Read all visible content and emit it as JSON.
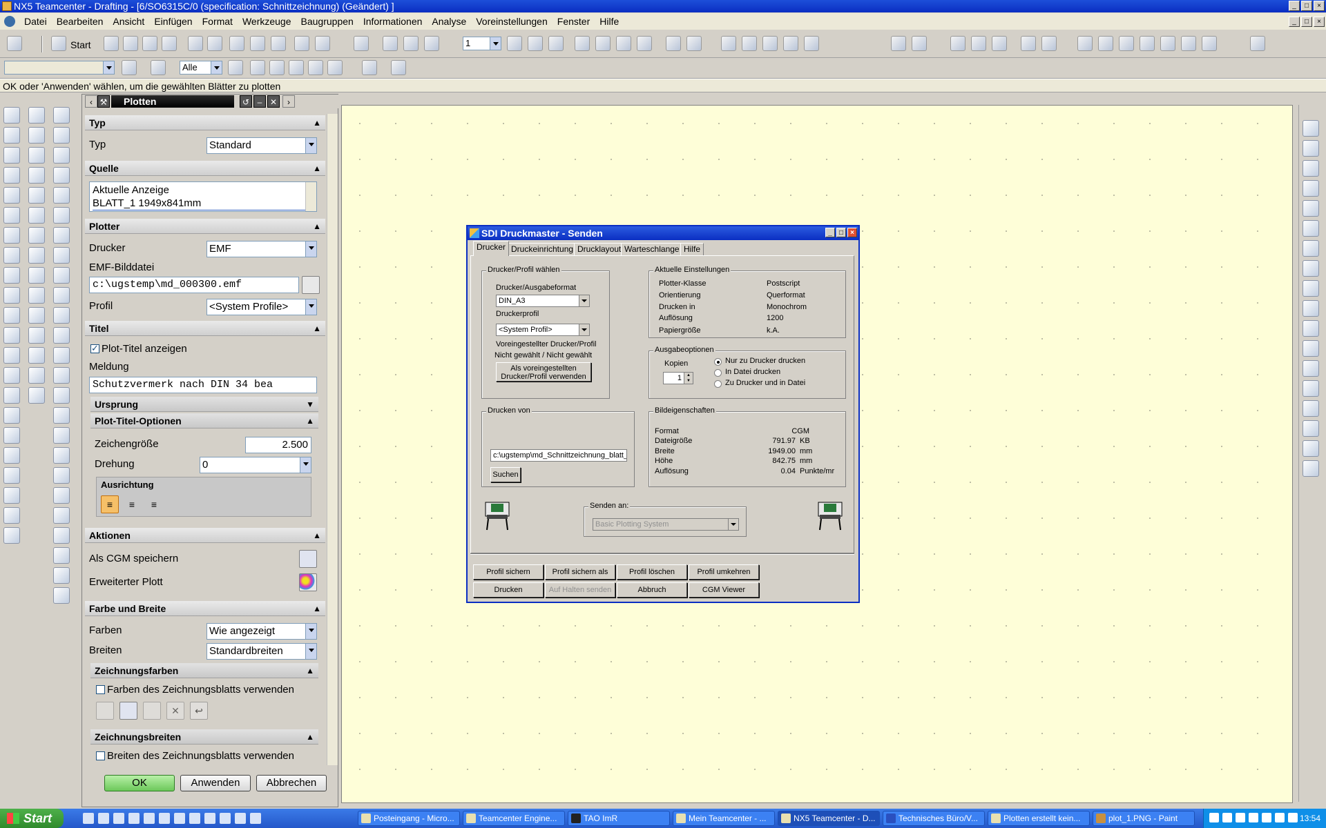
{
  "window": {
    "title": "NX5 Teamcenter - Drafting - [6/SO6315C/0 (specification: Schnittzeichnung) (Geändert) ]"
  },
  "menu": [
    "Datei",
    "Bearbeiten",
    "Ansicht",
    "Einfügen",
    "Format",
    "Werkzeuge",
    "Baugruppen",
    "Informationen",
    "Analyse",
    "Voreinstellungen",
    "Fenster",
    "Hilfe"
  ],
  "toolbar": {
    "start_label": "Start",
    "layer_value": "1",
    "filter_value": "Alle"
  },
  "status": "OK oder 'Anwenden' wählen, um die gewählten Blätter zu plotten",
  "plot": {
    "title": "Plotten",
    "typ": {
      "header": "Typ",
      "label": "Typ",
      "value": "Standard"
    },
    "quelle": {
      "header": "Quelle",
      "items": [
        "Aktuelle Anzeige",
        "BLATT_1  1949x841mm"
      ]
    },
    "plotter": {
      "header": "Plotter",
      "drucker_label": "Drucker",
      "drucker_value": "EMF",
      "emf_label": "EMF-Bilddatei",
      "emf_value": "c:\\ugstemp\\md_000300.emf",
      "profil_label": "Profil",
      "profil_value": "<System Profile>"
    },
    "titel": {
      "header": "Titel",
      "show_label": "Plot-Titel anzeigen",
      "meldung_label": "Meldung",
      "meldung_value": "Schutzvermerk nach DIN 34 bea",
      "ursprung": "Ursprung",
      "optionen": "Plot-Titel-Optionen",
      "size_label": "Zeichengröße",
      "size_value": "2.500",
      "rot_label": "Drehung",
      "rot_value": "0",
      "ausrichtung": "Ausrichtung"
    },
    "aktionen": {
      "header": "Aktionen",
      "cgm": "Als CGM speichern",
      "erweitert": "Erweiterter Plott"
    },
    "farbe": {
      "header": "Farbe und Breite",
      "farben_label": "Farben",
      "farben_value": "Wie angezeigt",
      "breiten_label": "Breiten",
      "breiten_value": "Standardbreiten",
      "zf": "Zeichnungsfarben",
      "zf_chk": "Farben des Zeichnungsblatts verwenden",
      "zb": "Zeichnungsbreiten",
      "zb_chk": "Breiten des Zeichnungsblatts verwenden"
    },
    "buttons": {
      "ok": "OK",
      "apply": "Anwenden",
      "cancel": "Abbrechen"
    }
  },
  "dialog": {
    "title": "SDI Druckmaster - Senden",
    "tabs": [
      "Drucker",
      "Druckeinrichtung",
      "Drucklayout",
      "Warteschlange",
      "Hilfe"
    ],
    "drucker_grp": "Drucker/Profil wählen",
    "format_label": "Drucker/Ausgabeformat",
    "format_value": "DIN_A3",
    "profil_label": "Druckerprofil",
    "profil_value": "<System Profil>",
    "vor_label": "Voreingestellter Drucker/Profil",
    "vor_value": "Nicht gewählt / Nicht gewählt",
    "vor_btn": "Als voreingestellten Drucker/Profil verwenden",
    "aktuell_grp": "Aktuelle Einstellungen",
    "aktuell": [
      [
        "Plotter-Klasse",
        "Postscript"
      ],
      [
        "Orientierung",
        "Querformat"
      ],
      [
        "Drucken in",
        "Monochrom"
      ],
      [
        "Auflösung",
        "1200"
      ],
      [
        "Papiergröße",
        "k.A."
      ]
    ],
    "ausgabe_grp": "Ausgabeoptionen",
    "kopien_label": "Kopien",
    "kopien_value": "1",
    "radios": [
      "Nur zu Drucker drucken",
      "In Datei drucken",
      "Zu Drucker und in Datei"
    ],
    "von_grp": "Drucken von",
    "von_value": "c:\\ugstemp\\md_Schnittzeichnung_blatt_",
    "suchen": "Suchen",
    "bild_grp": "Bildeigenschaften",
    "bild": [
      [
        "Format",
        "CGM",
        ""
      ],
      [
        "Dateigröße",
        "791.97",
        "KB"
      ],
      [
        "Breite",
        "1949.00",
        "mm"
      ],
      [
        "Höhe",
        "842.75",
        "mm"
      ],
      [
        "Auflösung",
        "0.04",
        "Punkte/mr"
      ]
    ],
    "senden_grp": "Senden an:",
    "senden_value": "Basic Plotting System",
    "btns_row1": [
      "Profil sichern",
      "Profil sichern als",
      "Profil löschen",
      "Profil umkehren"
    ],
    "btns_row2": [
      "Drucken",
      "Auf Halten senden",
      "Abbruch",
      "CGM Viewer"
    ]
  },
  "taskbar": {
    "start": "Start",
    "tasks": [
      "Posteingang - Micro...",
      "Teamcenter Engine...",
      "TAO ImR",
      "Mein Teamcenter - ...",
      "NX5 Teamcenter - D...",
      "Technisches Büro/V...",
      "Plotten erstellt kein...",
      "plot_1.PNG - Paint"
    ],
    "clock": "13:54"
  }
}
